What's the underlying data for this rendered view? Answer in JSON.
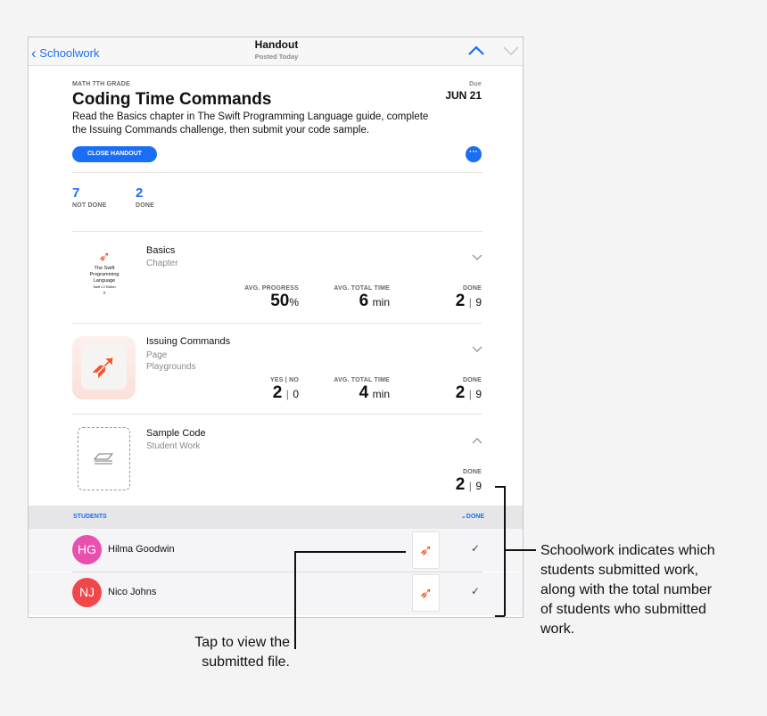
{
  "nav": {
    "back_label": "Schoolwork",
    "title": "Handout",
    "subtitle": "Posted Today"
  },
  "handout": {
    "class": "MATH 7TH GRADE",
    "title": "Coding Time Commands",
    "description_line1": "Read the Basics chapter in The Swift Programming Language guide, complete",
    "description_line2": "the Issuing Commands challenge, then submit your code sample.",
    "due_label": "Due",
    "due_date": "JUN 21",
    "close_button": "CLOSE HANDOUT"
  },
  "summary": {
    "not_done_count": "7",
    "not_done_label": "NOT DONE",
    "done_count": "2",
    "done_label": "DONE"
  },
  "activities": [
    {
      "title": "Basics",
      "sub1": "Chapter",
      "thumb_text": [
        "The Swift",
        "Programming",
        "Language",
        "Swift 2.2 Edition"
      ],
      "stats": [
        {
          "label": "AVG. PROGRESS",
          "value": "50",
          "unit": "%"
        },
        {
          "label": "AVG. TOTAL TIME",
          "value": "6",
          "unit": "min"
        },
        {
          "label": "DONE",
          "value": "2",
          "total": "9"
        }
      ]
    },
    {
      "title": "Issuing Commands",
      "sub1": "Page",
      "sub2": "Playgrounds",
      "stats": [
        {
          "label": "YES | NO",
          "value": "2",
          "total": "0"
        },
        {
          "label": "AVG. TOTAL TIME",
          "value": "4",
          "unit": "min"
        },
        {
          "label": "DONE",
          "value": "2",
          "total": "9"
        }
      ]
    },
    {
      "title": "Sample Code",
      "sub1": "Student Work",
      "stats": [
        {
          "label": "DONE",
          "value": "2",
          "total": "9"
        }
      ]
    }
  ],
  "students": {
    "header": "STUDENTS",
    "filter": "DONE",
    "list": [
      {
        "initials": "HG",
        "name": "Hilma Goodwin",
        "color": "#e94fae"
      },
      {
        "initials": "NJ",
        "name": "Nico Johns",
        "color": "#f0474d"
      }
    ]
  },
  "annotations": {
    "right": [
      "Schoolwork indicates which",
      "students submitted work,",
      "along with the total number",
      "of students who submitted",
      "work."
    ],
    "left": [
      "Tap to view the",
      "submitted file."
    ]
  },
  "colors": {
    "accent": "#1a6ef5"
  }
}
